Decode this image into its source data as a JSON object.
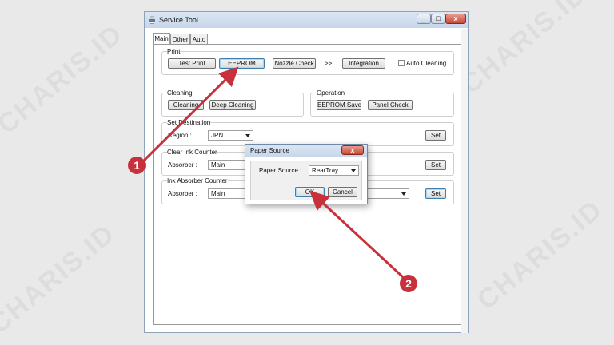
{
  "watermark": "CHARIS.ID",
  "window": {
    "title": "Service Tool",
    "controls": {
      "minimize": "_",
      "maximize": "□",
      "close": "x"
    }
  },
  "tabs": [
    {
      "label": "Main",
      "active": true
    },
    {
      "label": "Other",
      "active": false
    },
    {
      "label": "Auto",
      "active": false
    }
  ],
  "print": {
    "group_label": "Print",
    "test_print": "Test Print",
    "eeprom": "EEPROM",
    "nozzle_check": "Nozzle Check",
    "arrows": ">>",
    "integration": "Integration",
    "auto_cleaning": "Auto Cleaning",
    "auto_cleaning_checked": false
  },
  "cleaning": {
    "group_label": "Cleaning",
    "cleaning": "Cleaning",
    "deep_cleaning": "Deep Cleaning"
  },
  "operation": {
    "group_label": "Operation",
    "eeprom_save": "EEPROM Save",
    "panel_check": "Panel Check"
  },
  "set_destination": {
    "group_label": "Set Destination",
    "region_label": "Region :",
    "region_value": "JPN",
    "set": "Set"
  },
  "clear_ink_counter": {
    "group_label": "Clear Ink Counter",
    "absorber_label": "Absorber :",
    "absorber_value": "Main",
    "set": "Set"
  },
  "ink_absorber_counter": {
    "group_label": "Ink Absorber Counter",
    "absorber_label": "Absorber :",
    "absorber_value": "Main",
    "set": "Set"
  },
  "dialog": {
    "title": "Paper Source",
    "close": "x",
    "paper_source_label": "Paper Source :",
    "paper_source_value": "RearTray",
    "ok": "OK",
    "cancel": "Cancel"
  },
  "annotations": {
    "marker_1": "1",
    "marker_2": "2",
    "color": "#c8313b"
  }
}
